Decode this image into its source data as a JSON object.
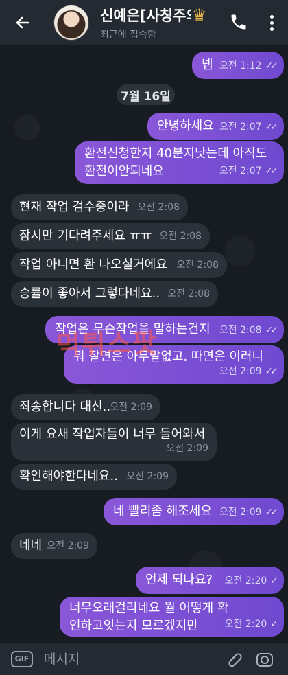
{
  "header": {
    "title": "신예은[사칭주의",
    "crown": "♛",
    "status": "최근에 접속함"
  },
  "date_divider": "7월 16일",
  "messages": [
    {
      "text": "넵",
      "time": "오전 1:12",
      "ticks": "✓✓"
    },
    {
      "text": "안녕하세요",
      "time": "오전 2:07",
      "ticks": "✓✓"
    },
    {
      "text": "환전신청한지 40분지낫는데 아직도 환전이안되네요",
      "time": "오전 2:07",
      "ticks": "✓✓"
    },
    {
      "text": "현재 작업 검수중이라",
      "time": "오전 2:08"
    },
    {
      "text": "잠시만 기다려주세요 ㅠㅠ",
      "time": "오전 2:08"
    },
    {
      "text": "작업 아니면 환 나오실거에요",
      "time": "오전 2:08"
    },
    {
      "text": "승률이 좋아서 그렇다네요..",
      "time": "오전 2:08"
    },
    {
      "text": "작업은 무슨작업을 말하는건지",
      "time": "오전 2:08",
      "ticks": "✓✓"
    },
    {
      "text": "뭐 잘면은 아무말없고. 따면은 이러니",
      "time": "오전 2:09",
      "ticks": "✓✓"
    },
    {
      "text": "죄송합니다 대신..",
      "time": "오전 2:09"
    },
    {
      "text": "이게 요새 작업자들이 너무 들어와서",
      "time": "오전 2:09"
    },
    {
      "text": "확인해야한다네요..",
      "time": "오전 2:09"
    },
    {
      "text": "네 빨리좀 해조세요",
      "time": "오전 2:09",
      "ticks": "✓✓"
    },
    {
      "text": "네네",
      "time": "오전 2:09"
    },
    {
      "text": "언제 되나요?",
      "time": "오전 2:20",
      "ticks": "✓"
    },
    {
      "text": "너무오래걸리네요 뭘 어떻게 확인하고잇는지 모르겠지만",
      "time": "오전 2:20",
      "ticks": "✓"
    }
  ],
  "watermark": "먹튀스팟",
  "composer": {
    "gif_label": "GIF",
    "placeholder": "메시지"
  },
  "icons": {
    "back": "back-arrow-icon",
    "call": "phone-icon",
    "menu": "more-vert-icon",
    "attach": "paperclip-icon",
    "camera": "camera-icon"
  },
  "colors": {
    "outgoing_bubble": "#7b50d5",
    "incoming_bubble": "#2b3139",
    "header": "#242a31",
    "background": "#171c22"
  }
}
